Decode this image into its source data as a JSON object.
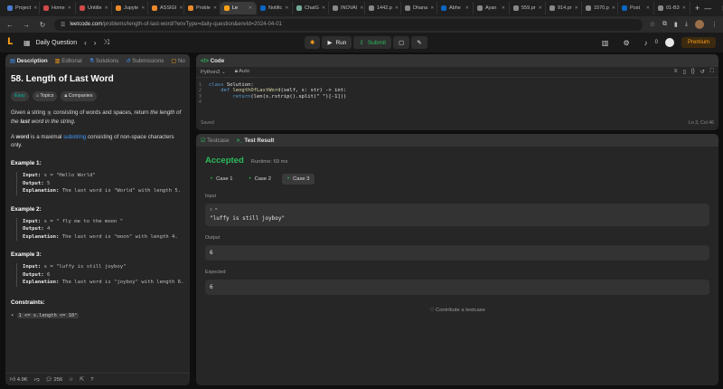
{
  "browser": {
    "tabs": [
      {
        "label": "Project",
        "color": "#4a7bd0"
      },
      {
        "label": "Home",
        "color": "#d04a4a"
      },
      {
        "label": "Untitle",
        "color": "#d04a4a"
      },
      {
        "label": "Jupyte",
        "color": "#e98a2a"
      },
      {
        "label": "ASSIGI",
        "color": "#e98a2a"
      },
      {
        "label": "Proble",
        "color": "#e98a2a"
      },
      {
        "label": "Le",
        "color": "#ffa116"
      },
      {
        "label": "Notific",
        "color": "#0a66c2"
      },
      {
        "label": "ChatG",
        "color": "#74aa9c"
      },
      {
        "label": "INOVAI",
        "color": "#888888"
      },
      {
        "label": "1442.p",
        "color": "#888888"
      },
      {
        "label": "Dhana",
        "color": "#888888"
      },
      {
        "label": "Abhe",
        "color": "#0a66c2"
      },
      {
        "label": "Ayan",
        "color": "#888888"
      },
      {
        "label": "559.pr",
        "color": "#888888"
      },
      {
        "label": "914.pr",
        "color": "#888888"
      },
      {
        "label": "1570.p",
        "color": "#888888"
      },
      {
        "label": "Post",
        "color": "#0a66c2"
      },
      {
        "label": "01-B3",
        "color": "#888888"
      }
    ],
    "url_host": "leetcode.com",
    "url_path": "/problems/length-of-last-word/?envType=daily-question&envId=2024-04-01"
  },
  "lcnav": {
    "daily_label": "Daily Question",
    "run_label": "Run",
    "submit_label": "Submit",
    "streak_count": "0",
    "premium_label": "Premium"
  },
  "desc": {
    "tabs": {
      "description": "Description",
      "editorial": "Editorial",
      "solutions": "Solutions",
      "submissions": "Submissions",
      "notes": "No"
    },
    "title": "58. Length of Last Word",
    "badges": {
      "difficulty": "Easy",
      "topics": "Topics",
      "companies": "Companies"
    },
    "para1": {
      "a": "Given a string ",
      "code": "s",
      "b": " consisting of words and spaces, return ",
      "c": "the length of the ",
      "d": "last",
      "e": " word in the string."
    },
    "para2": {
      "a": "A ",
      "b": "word",
      "c": " is a maximal ",
      "link": "substring",
      "d": " consisting of non-space characters only."
    },
    "examples": [
      {
        "title": "Example 1:",
        "input": "s = \"Hello World\"",
        "output": "5",
        "explanation": "The last word is \"World\" with length 5."
      },
      {
        "title": "Example 2:",
        "input": "s = \"   fly me   to   the moon  \"",
        "output": "4",
        "explanation": "The last word is \"moon\" with length 4."
      },
      {
        "title": "Example 3:",
        "input": "s = \"luffy is still joyboy\"",
        "output": "6",
        "explanation": "The last word is \"joyboy\" with length 6."
      }
    ],
    "labels": {
      "input": "Input:",
      "output": "Output:",
      "explanation": "Explanation:"
    },
    "constraints_title": "Constraints:",
    "constraint1": "1 <= s.length <= 10⁴",
    "footer": {
      "likes": "4.9K",
      "comments": "256"
    }
  },
  "code": {
    "header": "Code",
    "language": "Python3",
    "mode": "Auto",
    "lines": [
      {
        "n": "1",
        "a": "class ",
        "b": "Solution:"
      },
      {
        "n": "2",
        "a": "    def ",
        "fn": "lengthOfLastWord",
        "b": "(self, s: str) -> int:"
      },
      {
        "n": "3",
        "a": "        return",
        "b": "(len(s.rstrip().split(\" \")[-1]))"
      },
      {
        "n": "4",
        "a": "",
        "b": ""
      }
    ],
    "status": "Saved",
    "cursor": "Ln 3, Col 46"
  },
  "result": {
    "tab_testcase": "Testcase",
    "tab_result": "Test Result",
    "status": "Accepted",
    "runtime": "Runtime: 69 ms",
    "cases": [
      "Case 1",
      "Case 2",
      "Case 3"
    ],
    "input_label": "Input",
    "input_var": "s =",
    "input_value": "\"luffy is still joyboy\"",
    "output_label": "Output",
    "output_value": "6",
    "expected_label": "Expected",
    "expected_value": "6",
    "contribute": "Contribute a testcase"
  }
}
